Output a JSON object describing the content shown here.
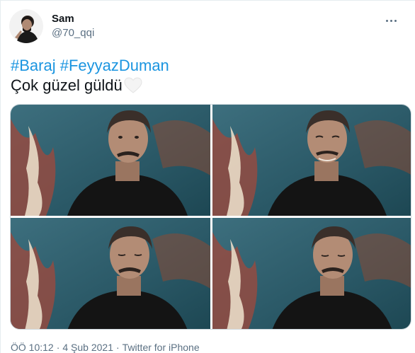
{
  "author": {
    "display_name": "Sam",
    "handle": "@70_qqi"
  },
  "tweet": {
    "hashtags": [
      "#Baraj",
      "#FeyyazDuman"
    ],
    "text": "Çok güzel güldü",
    "emoji_icon": "white-heart-icon"
  },
  "media": {
    "count": 4,
    "description_icon": "photo-grid"
  },
  "meta": {
    "time": "ÖÖ 10:12",
    "date": "4 Şub 2021",
    "source": "Twitter for iPhone",
    "separator": "·"
  },
  "colors": {
    "hashtag": "#1b95e0",
    "secondary_text": "#5b7083",
    "text": "#0f1419"
  }
}
